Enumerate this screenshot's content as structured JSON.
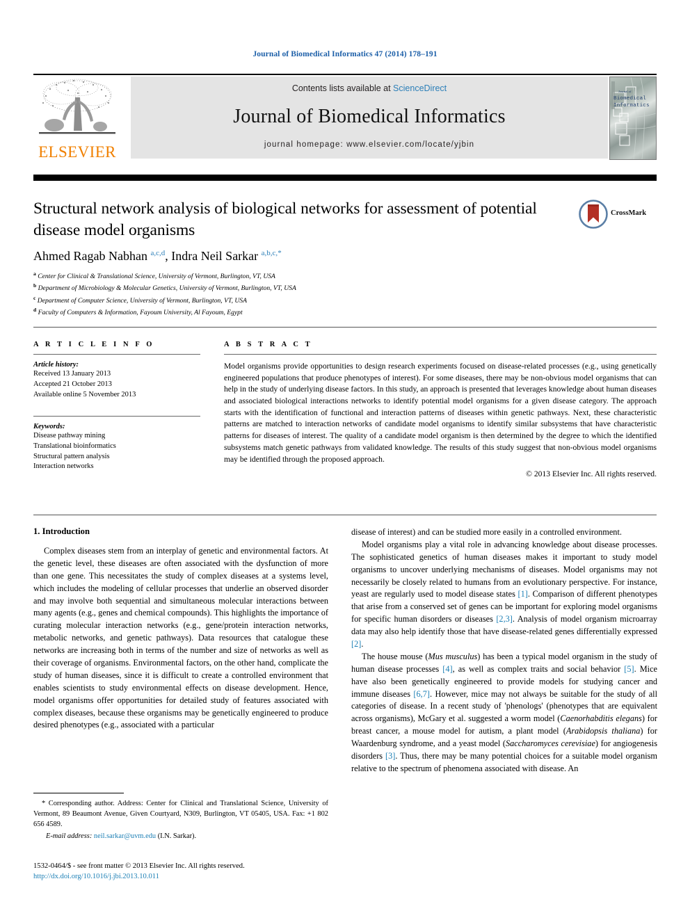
{
  "running_head": "Journal of Biomedical Informatics 47 (2014) 178–191",
  "masthead": {
    "contents_prefix": "Contents lists available at ",
    "sciencedirect": "ScienceDirect",
    "journal_name": "Journal of Biomedical Informatics",
    "homepage": "journal homepage: www.elsevier.com/locate/yjbin",
    "publisher_wordmark": "ELSEVIER",
    "cover_supertitle": "Journal of",
    "cover_title_line1": "Biomedical",
    "cover_title_line2": "Informatics",
    "accent_orange": "#f08000",
    "link_blue": "#2c7fb8"
  },
  "article": {
    "title": "Structural network analysis of biological networks for assessment of potential disease model organisms",
    "crossmark_label": "CrossMark",
    "authors_html": "Ahmed Ragab Nabhan <sup>a,c,d</sup>, Indra Neil Sarkar <sup>a,b,c,</sup><sup>*</sup>",
    "affiliations": [
      {
        "marker": "a",
        "text": "Center for Clinical & Translational Science, University of Vermont, Burlington, VT, USA"
      },
      {
        "marker": "b",
        "text": "Department of Microbiology & Molecular Genetics, University of Vermont, Burlington, VT, USA"
      },
      {
        "marker": "c",
        "text": "Department of Computer Science, University of Vermont, Burlington, VT, USA"
      },
      {
        "marker": "d",
        "text": "Faculty of Computers & Information, Fayoum University, Al Fayoum, Egypt"
      }
    ]
  },
  "article_info": {
    "heading": "A R T I C L E   I N F O",
    "history_label": "Article history:",
    "history": [
      "Received 13 January 2013",
      "Accepted 21 October 2013",
      "Available online 5 November 2013"
    ],
    "keywords_label": "Keywords:",
    "keywords": [
      "Disease pathway mining",
      "Translational bioinformatics",
      "Structural pattern analysis",
      "Interaction networks"
    ]
  },
  "abstract": {
    "heading": "A B S T R A C T",
    "text": "Model organisms provide opportunities to design research experiments focused on disease-related processes (e.g., using genetically engineered populations that produce phenotypes of interest). For some diseases, there may be non-obvious model organisms that can help in the study of underlying disease factors. In this study, an approach is presented that leverages knowledge about human diseases and associated biological interactions networks to identify potential model organisms for a given disease category. The approach starts with the identification of functional and interaction patterns of diseases within genetic pathways. Next, these characteristic patterns are matched to interaction networks of candidate model organisms to identify similar subsystems that have characteristic patterns for diseases of interest. The quality of a candidate model organism is then determined by the degree to which the identified subsystems match genetic pathways from validated knowledge. The results of this study suggest that non-obvious model organisms may be identified through the proposed approach.",
    "copyright": "© 2013 Elsevier Inc. All rights reserved."
  },
  "body": {
    "section_heading": "1. Introduction",
    "left_paragraph_1": "Complex diseases stem from an interplay of genetic and environmental factors. At the genetic level, these diseases are often associated with the dysfunction of more than one gene. This necessitates the study of complex diseases at a systems level, which includes the modeling of cellular processes that underlie an observed disorder and may involve both sequential and simultaneous molecular interactions between many agents (e.g., genes and chemical compounds). This highlights the importance of curating molecular interaction networks (e.g., gene/protein interaction networks, metabolic networks, and genetic pathways). Data resources that catalogue these networks are increasing both in terms of the number and size of networks as well as their coverage of organisms. Environmental factors, on the other hand, complicate the study of human diseases, since it is difficult to create a controlled environment that enables scientists to study environmental effects on disease development. Hence, model organisms offer opportunities for detailed study of features associated with complex diseases, because these organisms may be genetically engineered to produce desired phenotypes (e.g., associated with a particular",
    "right_paragraph_1_continuation": "disease of interest) and can be studied more easily in a controlled environment.",
    "right_paragraph_2_parts": [
      {
        "t": "Model organisms play a vital role in advancing knowledge about disease processes. The sophisticated genetics of human diseases makes it important to study model organisms to uncover underlying mechanisms of diseases. Model organisms may not necessarily be closely related to humans from an evolutionary perspective. For instance, yeast are regularly used to model disease states ",
        "k": "plain"
      },
      {
        "t": "[1]",
        "k": "ref"
      },
      {
        "t": ". Comparison of different phenotypes that arise from a conserved set of genes can be important for exploring model organisms for specific human disorders or diseases ",
        "k": "plain"
      },
      {
        "t": "[2,3]",
        "k": "ref"
      },
      {
        "t": ". Analysis of model organism microarray data may also help identify those that have disease-related genes differentially expressed ",
        "k": "plain"
      },
      {
        "t": "[2]",
        "k": "ref"
      },
      {
        "t": ".",
        "k": "plain"
      }
    ],
    "right_paragraph_3_parts": [
      {
        "t": "The house mouse (",
        "k": "plain"
      },
      {
        "t": "Mus musculus",
        "k": "ital"
      },
      {
        "t": ") has been a typical model organism in the study of human disease processes ",
        "k": "plain"
      },
      {
        "t": "[4]",
        "k": "ref"
      },
      {
        "t": ", as well as complex traits and social behavior ",
        "k": "plain"
      },
      {
        "t": "[5]",
        "k": "ref"
      },
      {
        "t": ". Mice have also been genetically engineered to provide models for studying cancer and immune diseases ",
        "k": "plain"
      },
      {
        "t": "[6,7]",
        "k": "ref"
      },
      {
        "t": ". However, mice may not always be suitable for the study of all categories of disease. In a recent study of 'phenologs' (phenotypes that are equivalent across organisms), McGary et al. suggested a worm model (",
        "k": "plain"
      },
      {
        "t": "Caenorhabditis elegans",
        "k": "ital"
      },
      {
        "t": ") for breast cancer, a mouse model for autism, a plant model (",
        "k": "plain"
      },
      {
        "t": "Arabidopsis thaliana",
        "k": "ital"
      },
      {
        "t": ") for Waardenburg syndrome, and a yeast model (",
        "k": "plain"
      },
      {
        "t": "Saccharomyces cerevisiae",
        "k": "ital"
      },
      {
        "t": ") for angiogenesis disorders ",
        "k": "plain"
      },
      {
        "t": "[3]",
        "k": "ref"
      },
      {
        "t": ". Thus, there may be many potential choices for a suitable model organism relative to the spectrum of phenomena associated with disease. An",
        "k": "plain"
      }
    ]
  },
  "footnote": {
    "marker": "*",
    "text": "Corresponding author. Address: Center for Clinical and Translational Science, University of Vermont, 89 Beaumont Avenue, Given Courtyard, N309, Burlington, VT 05405, USA. Fax: +1 802 656 4589.",
    "email_label": "E-mail address:",
    "email": "neil.sarkar@uvm.edu",
    "email_owner": "(I.N. Sarkar)."
  },
  "page_footer": {
    "issn_line": "1532-0464/$ - see front matter © 2013 Elsevier Inc. All rights reserved.",
    "doi": "http://dx.doi.org/10.1016/j.jbi.2013.10.011"
  }
}
